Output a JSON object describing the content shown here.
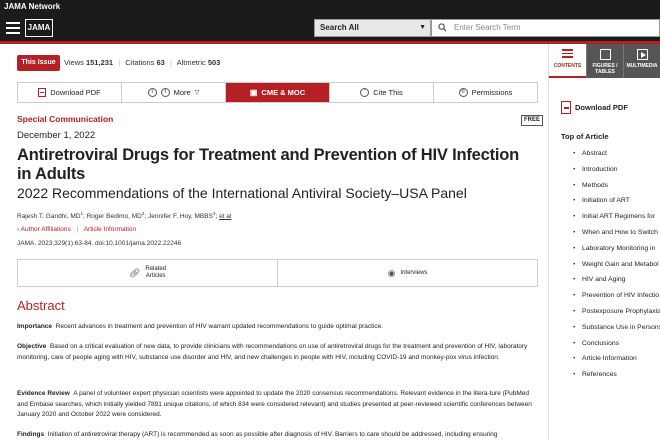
{
  "header": {
    "network_label": "JAMA Network",
    "logo": "JAMA",
    "search_scope": "Search All",
    "search_placeholder": "Enter Search Term"
  },
  "metrics": {
    "issue_button": "This Issue",
    "views_label": "Views",
    "views": "151,231",
    "citations_label": "Citations",
    "citations": "63",
    "altmetric_label": "Altmetric",
    "altmetric": "503"
  },
  "toolbar": {
    "download_pdf": "Download PDF",
    "more": "More",
    "cme": "CME & MOC",
    "cite": "Cite This",
    "permissions": "Permissions"
  },
  "article": {
    "type": "Special Communication",
    "free_badge": "FREE",
    "date": "December 1, 2022",
    "title": "Antiretroviral Drugs for Treatment and Prevention of HIV Infection in Adults",
    "subtitle": "2022 Recommendations of the International Antiviral Society–USA Panel",
    "authors": [
      {
        "name": "Rajesh T. Gandhi, MD",
        "sup": "1"
      },
      {
        "name": "Roger Bedimo, MD",
        "sup": "2"
      },
      {
        "name": "Jennifer F. Hoy, MBBS",
        "sup": "3"
      }
    ],
    "etal": "et al",
    "author_affiliations": "Author Affiliations",
    "article_information": "Article Information",
    "citation": "JAMA. 2023;329(1):63-84. doi:10.1001/jama.2022.22246",
    "related_label_1": "Related",
    "related_label_2": "Articles",
    "interviews": "Interviews"
  },
  "abstract": {
    "heading": "Abstract",
    "importance_label": "Importance",
    "importance_text": "Recent advances in treatment and prevention of HIV warrant updated recommendations to guide optimal practice.",
    "objective_label": "Objective",
    "objective_text": "Based on a critical evaluation of new data, to provide clinicians with recommendations on use of antiretroviral drugs for the treatment and prevention of HIV, laboratory monitoring, care of people aging with HIV, substance use disorder and HIV, and new challenges in people with HIV, including COVID-19 and monkey-pox virus infection.",
    "evidence_label": "Evidence Review",
    "evidence_text": "A panel of volunteer expert physician scientists were appointed to update the 2020 consensus recommendations. Relevant evidence in the litera-ture (PubMed and Embase searches, which initially yielded 7891 unique citations, of which 834 were considered relevant) and studies presented at peer-reviewed scientific conferences between January 2020 and October 2022 were considered.",
    "findings_label": "Findings",
    "findings_text": "Initiation of antiretroviral therapy (ART) is recommended as soon as possible after diagnosis of HIV. Barriers to care should be addressed, including ensuring"
  },
  "sidebar": {
    "tabs": [
      {
        "label": "CONTENTS"
      },
      {
        "label_1": "FIGURES /",
        "label_2": "TABLES"
      },
      {
        "label": "MULTIMEDIA"
      }
    ],
    "download_pdf": "Download PDF",
    "toc_heading": "Top of Article",
    "toc": [
      "Abstract",
      "Introduction",
      "Methods",
      "Initiation of ART",
      "Initial ART Regimens for",
      "When and How to Switch",
      "Laboratory Monitoring in",
      "Weight Gain and Metabol",
      "HIV and Aging",
      "Prevention of HIV Infectio",
      "Postexposure Prophylaxis",
      "Substance Use in Persons",
      "Conclusions",
      "Article Information",
      "References"
    ]
  },
  "colors": {
    "brand_red": "#b52025",
    "header_dark": "#1b1b1b"
  }
}
